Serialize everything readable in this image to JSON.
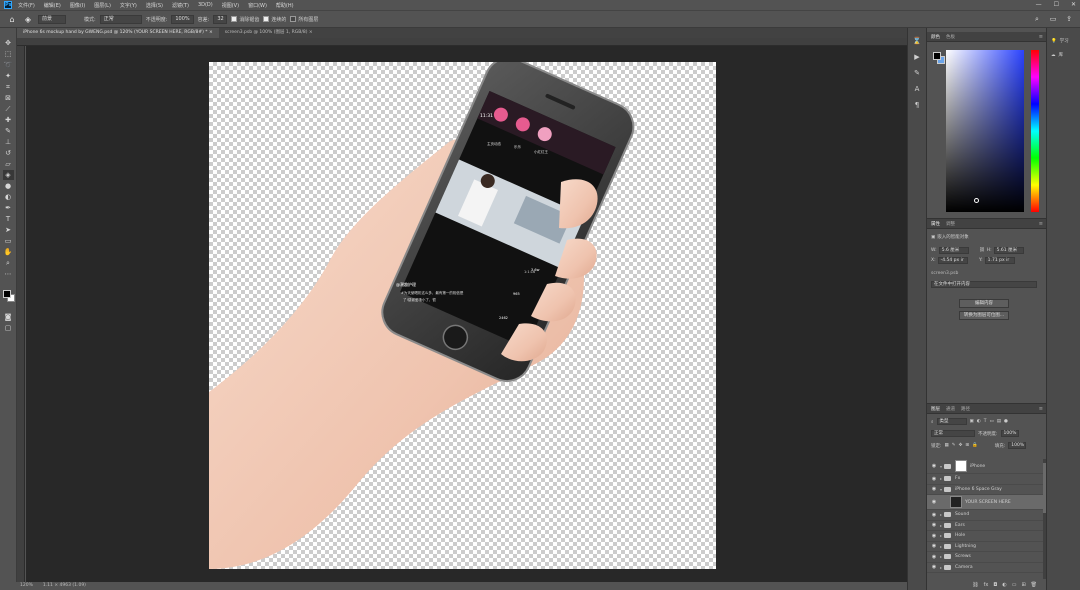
{
  "app": {
    "logo": "Ps"
  },
  "menu": [
    "文件(F)",
    "编辑(E)",
    "图像(I)",
    "图层(L)",
    "文字(Y)",
    "选择(S)",
    "滤镜(T)",
    "3D(D)",
    "视图(V)",
    "窗口(W)",
    "帮助(H)"
  ],
  "window_controls": [
    "—",
    "☐",
    "✕"
  ],
  "options": {
    "fill_label": "前景",
    "mode_label": "模式:",
    "mode_value": "正常",
    "opacity_label": "不透明度:",
    "opacity_value": "100%",
    "tolerance_label": "容差:",
    "tolerance_value": "32",
    "antialias_label": "消除锯齿",
    "contiguous_label": "连续的",
    "all_layers_label": "所有图层"
  },
  "tabs": [
    {
      "label": "iPhone 6s mockup hand by GWENG.psd @ 120% (YOUR SCREEN HERE, RGB/8#) * ×"
    },
    {
      "label": "screen3.psb @ 100% (图层 1, RGB/8) ×"
    }
  ],
  "status": {
    "zoom": "120%",
    "doc_info": "1.11 × 4963 (1.09)"
  },
  "phone_screen": {
    "time": "11:31",
    "avatar_labels": [
      "主页动态",
      "乐乐",
      "小红红王"
    ],
    "caption_title": "@潮趣护理",
    "caption_line1": "#为天使喝彩这么多，最有第一的相信是",
    "caption_line2": "了!感谢爱哦小了，很",
    "video_time": "1:1:16",
    "like_count": "3.6w",
    "comment_count": "965",
    "share_count": "2462"
  },
  "color_panel": {
    "tabs": [
      "颜色",
      "色板"
    ]
  },
  "properties_panel": {
    "tabs": [
      "属性",
      "调整"
    ],
    "layer_kind": "嵌入的智能对象",
    "w_label": "W:",
    "w_value": "5.6 厘米",
    "h_label": "H:",
    "h_value": "5.61 厘米",
    "x_label": "X:",
    "x_value": "-4.54 px ir",
    "y_label": "Y:",
    "y_value": "1.71 px ir",
    "file_name": "screen3.psb",
    "file_box": "在文件中打开内容",
    "edit_button": "编辑内容",
    "convert_button": "转换为图层可位图..."
  },
  "layers_panel": {
    "tabs": [
      "图层",
      "通道",
      "路径"
    ],
    "kind_label": "类型",
    "blend_mode": "正常",
    "opacity_label": "不透明度:",
    "opacity_value": "100%",
    "lock_label": "锁定:",
    "fill_label": "填充:",
    "fill_value": "100%",
    "layers": [
      {
        "name": "iPhone"
      },
      {
        "name": "Fx"
      },
      {
        "name": "iPhone 6 Space Gray"
      },
      {
        "name": "YOUR SCREEN HERE"
      },
      {
        "name": "Sound"
      },
      {
        "name": "Ears"
      },
      {
        "name": "Hole"
      },
      {
        "name": "Lightning"
      },
      {
        "name": "Screws"
      },
      {
        "name": "Camera"
      }
    ]
  },
  "far_panel": {
    "items": [
      "学习",
      "库"
    ]
  }
}
